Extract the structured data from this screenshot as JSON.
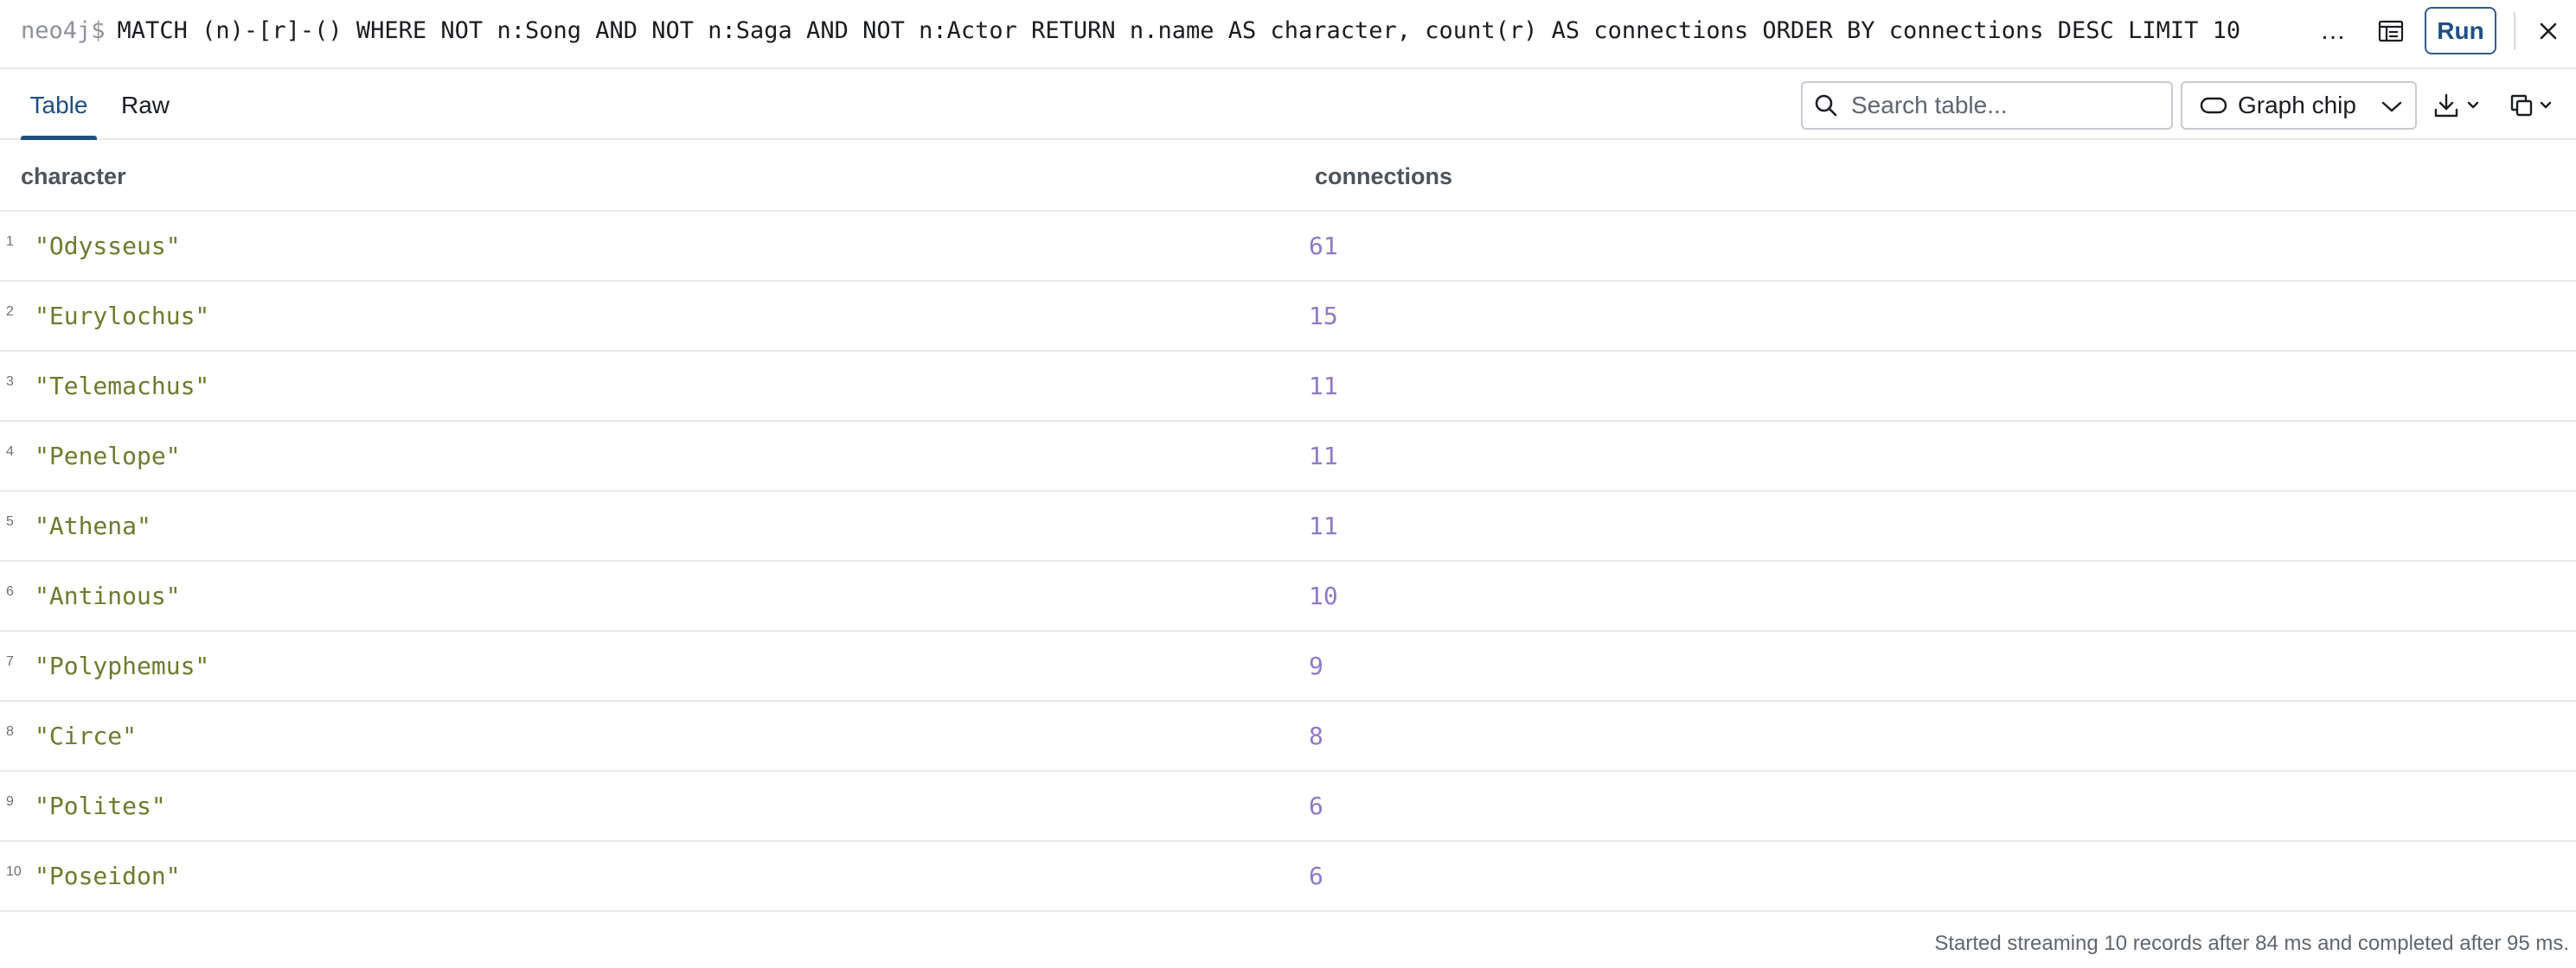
{
  "query_bar": {
    "prompt": "neo4j$",
    "query": "MATCH (n)-[r]-() WHERE NOT n:Song AND NOT n:Saga AND NOT n:Actor RETURN n.name AS character, count(r) AS connections ORDER BY connections DESC LIMIT 10",
    "more_label": "…",
    "run_label": "Run",
    "icons": [
      "layout-icon",
      "close-icon"
    ]
  },
  "toolbar": {
    "tabs": [
      {
        "label": "Table",
        "active": true
      },
      {
        "label": "Raw",
        "active": false
      }
    ],
    "search_placeholder": "Search table...",
    "chip_select_value": "Graph chip",
    "icons": [
      "search-icon",
      "pill-icon",
      "chevron-down-icon",
      "download-icon",
      "copy-icon"
    ]
  },
  "table": {
    "columns": [
      "character",
      "connections"
    ],
    "rows": [
      {
        "num": "1",
        "character": "\"Odysseus\"",
        "connections": "61"
      },
      {
        "num": "2",
        "character": "\"Eurylochus\"",
        "connections": "15"
      },
      {
        "num": "3",
        "character": "\"Telemachus\"",
        "connections": "11"
      },
      {
        "num": "4",
        "character": "\"Penelope\"",
        "connections": "11"
      },
      {
        "num": "5",
        "character": "\"Athena\"",
        "connections": "11"
      },
      {
        "num": "6",
        "character": "\"Antinous\"",
        "connections": "10"
      },
      {
        "num": "7",
        "character": "\"Polyphemus\"",
        "connections": "9"
      },
      {
        "num": "8",
        "character": "\"Circe\"",
        "connections": "8"
      },
      {
        "num": "9",
        "character": "\"Polites\"",
        "connections": "6"
      },
      {
        "num": "10",
        "character": "\"Poseidon\"",
        "connections": "6"
      }
    ]
  },
  "status": "Started streaming 10 records after 84 ms and completed after 95 ms.",
  "colors": {
    "accent": "#1f4f82",
    "string_value": "#6f7a2f",
    "number_value": "#9178c8",
    "border": "#e6e8eb"
  }
}
